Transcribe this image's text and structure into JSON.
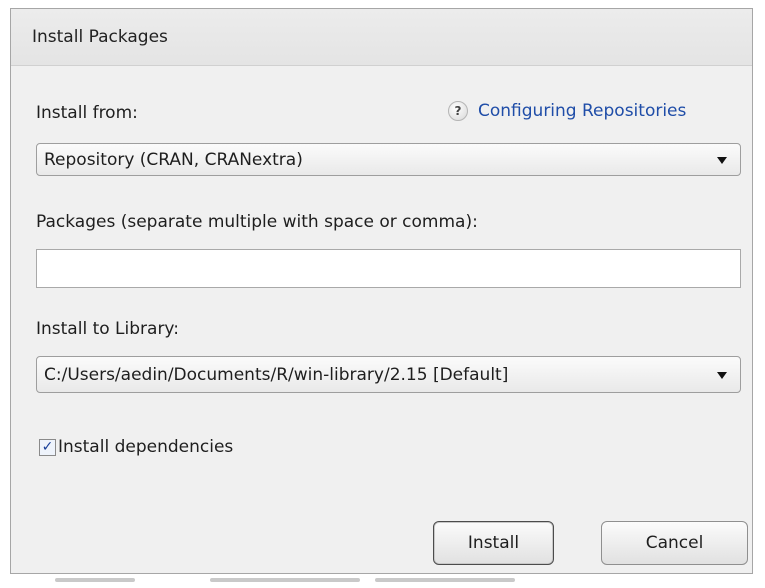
{
  "dialog": {
    "title": "Install Packages"
  },
  "install_from": {
    "label": "Install from:",
    "help_icon_glyph": "?",
    "help_link": "Configuring Repositories",
    "selected": "Repository (CRAN, CRANextra)"
  },
  "packages": {
    "label": "Packages (separate multiple with space or comma):",
    "value": "",
    "placeholder": ""
  },
  "library": {
    "label": "Install to Library:",
    "selected": "C:/Users/aedin/Documents/R/win-library/2.15 [Default]"
  },
  "dependencies": {
    "label": "Install dependencies",
    "checked": true,
    "check_glyph": "✓"
  },
  "buttons": {
    "install": "Install",
    "cancel": "Cancel"
  },
  "icons": {
    "help": "question-mark-icon",
    "dropdown": "chevron-down-icon",
    "check": "checkmark-icon"
  },
  "colors": {
    "link": "#1f4da8",
    "dialog_bg": "#f0f0f0",
    "checkbox_mark": "#1a3f99"
  }
}
